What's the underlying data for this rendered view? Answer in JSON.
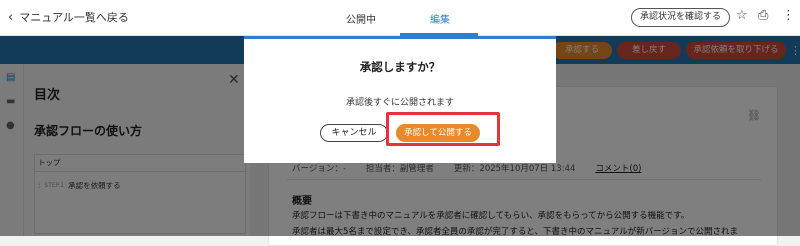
{
  "topbar": {
    "back_label": "マニュアル一覧へ戻る",
    "tab_published": "公開中",
    "tab_edit": "編集",
    "confirm_button": "承認状況を確認する",
    "icons": {
      "back": "chevron-left-icon",
      "star": "star-icon",
      "print": "print-icon",
      "more": "more-vertical-icon"
    }
  },
  "actionbar": {
    "approve_label": "承認する",
    "return_label": "差し戻す",
    "withdraw_label": "承認依頼を取り下げる",
    "colors": {
      "band": "#2574b3",
      "approve": "#e88a2b",
      "danger": "#cf4a3a"
    }
  },
  "toc": {
    "title": "目次",
    "heading": "承認フローの使い方",
    "section": "トップ",
    "step_no": "STEP.1",
    "step_label": "承認を依頼する"
  },
  "document": {
    "version": "バージョン：-",
    "owner": "担当者：副管理者",
    "updated": "更新：2025年10月07日 13:44",
    "comment": "コメント(0)",
    "section_title": "概要",
    "paragraph1": "承認フローは下書き中のマニュアルを承認者に確認してもらい、承認をもらってから公開する機能です。",
    "paragraph2": "承認者は最大5名まで設定でき、承認者全員の承認が完了すると、下書き中のマニュアルが新バージョンで公開されま"
  },
  "modal": {
    "title": "承認しますか？",
    "message": "承認後すぐに公開されます",
    "cancel_label": "キャンセル",
    "approve_label": "承認して公開する",
    "highlight_color": "#e8323c"
  }
}
